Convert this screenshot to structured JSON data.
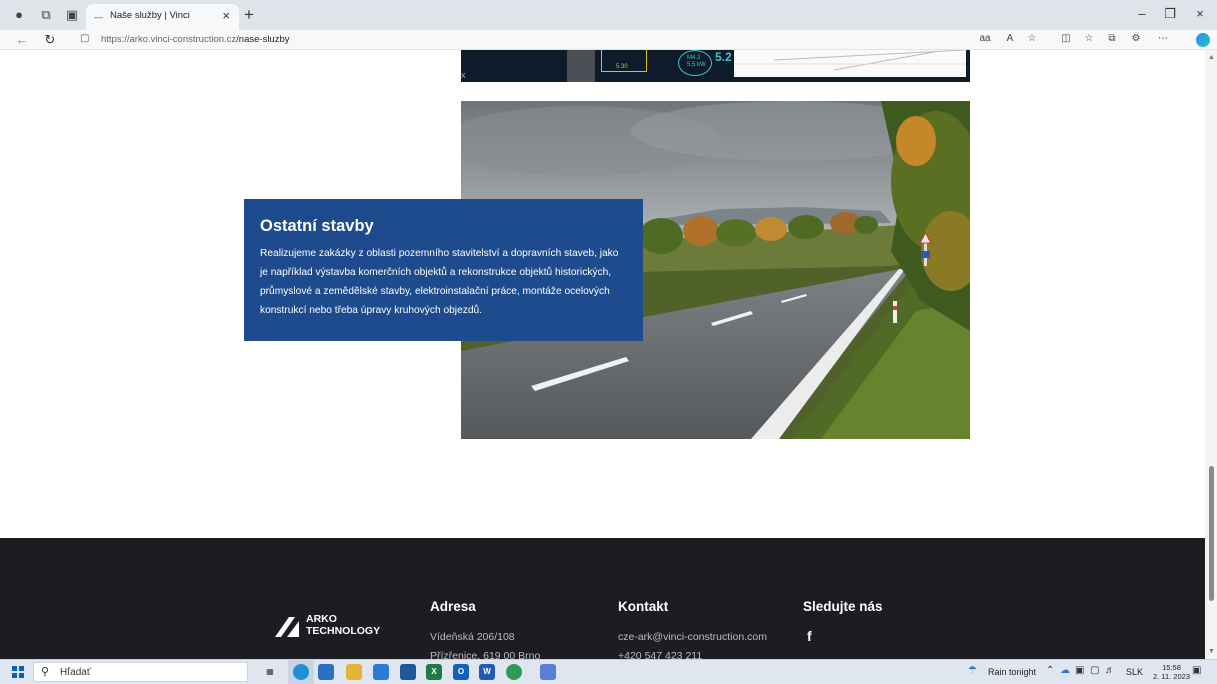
{
  "browser": {
    "tab_title": "Naše služby | Vinci",
    "url_host": "https://arko.vinci-construction.cz",
    "url_path": "/nase-sluzby"
  },
  "page": {
    "drawing_labels": {
      "dimension": "5.30",
      "motor_line1": "M4.2",
      "motor_line2": "5,5 kW",
      "big_value": "5.2"
    },
    "card": {
      "title": "Ostatní stavby",
      "text": "Realizujeme zakázky z oblasti pozemního stavitelství a dopravních staveb, jako je například výstavba komerčních objektů a rekonstrukce objektů historických, průmyslové a zemědělské stavby, elektroinstalační práce, montáže ocelových konstrukcí nebo třeba úpravy kruhových objezdů."
    }
  },
  "footer": {
    "logo_line1": "ARKO",
    "logo_line2": "TECHNOLOGY",
    "address": {
      "heading": "Adresa",
      "line1": "Vídeňská 206/108",
      "line2": "Přízřenice, 619 00 Brno"
    },
    "contact": {
      "heading": "Kontakt",
      "email": "cze-ark@vinci-construction.com",
      "phone": "+420 547 423 211"
    },
    "social": {
      "heading": "Sledujte nás",
      "facebook": "f"
    }
  },
  "taskbar": {
    "search_placeholder": "Hľadať",
    "weather": "Rain tonight",
    "language": "SLK",
    "time": "15:58",
    "date": "2. 11. 2023"
  },
  "colors": {
    "card_blue": "#1d4b8e",
    "footer_bg": "#1c1d22",
    "titlebar_bg": "#dfe3ea"
  }
}
